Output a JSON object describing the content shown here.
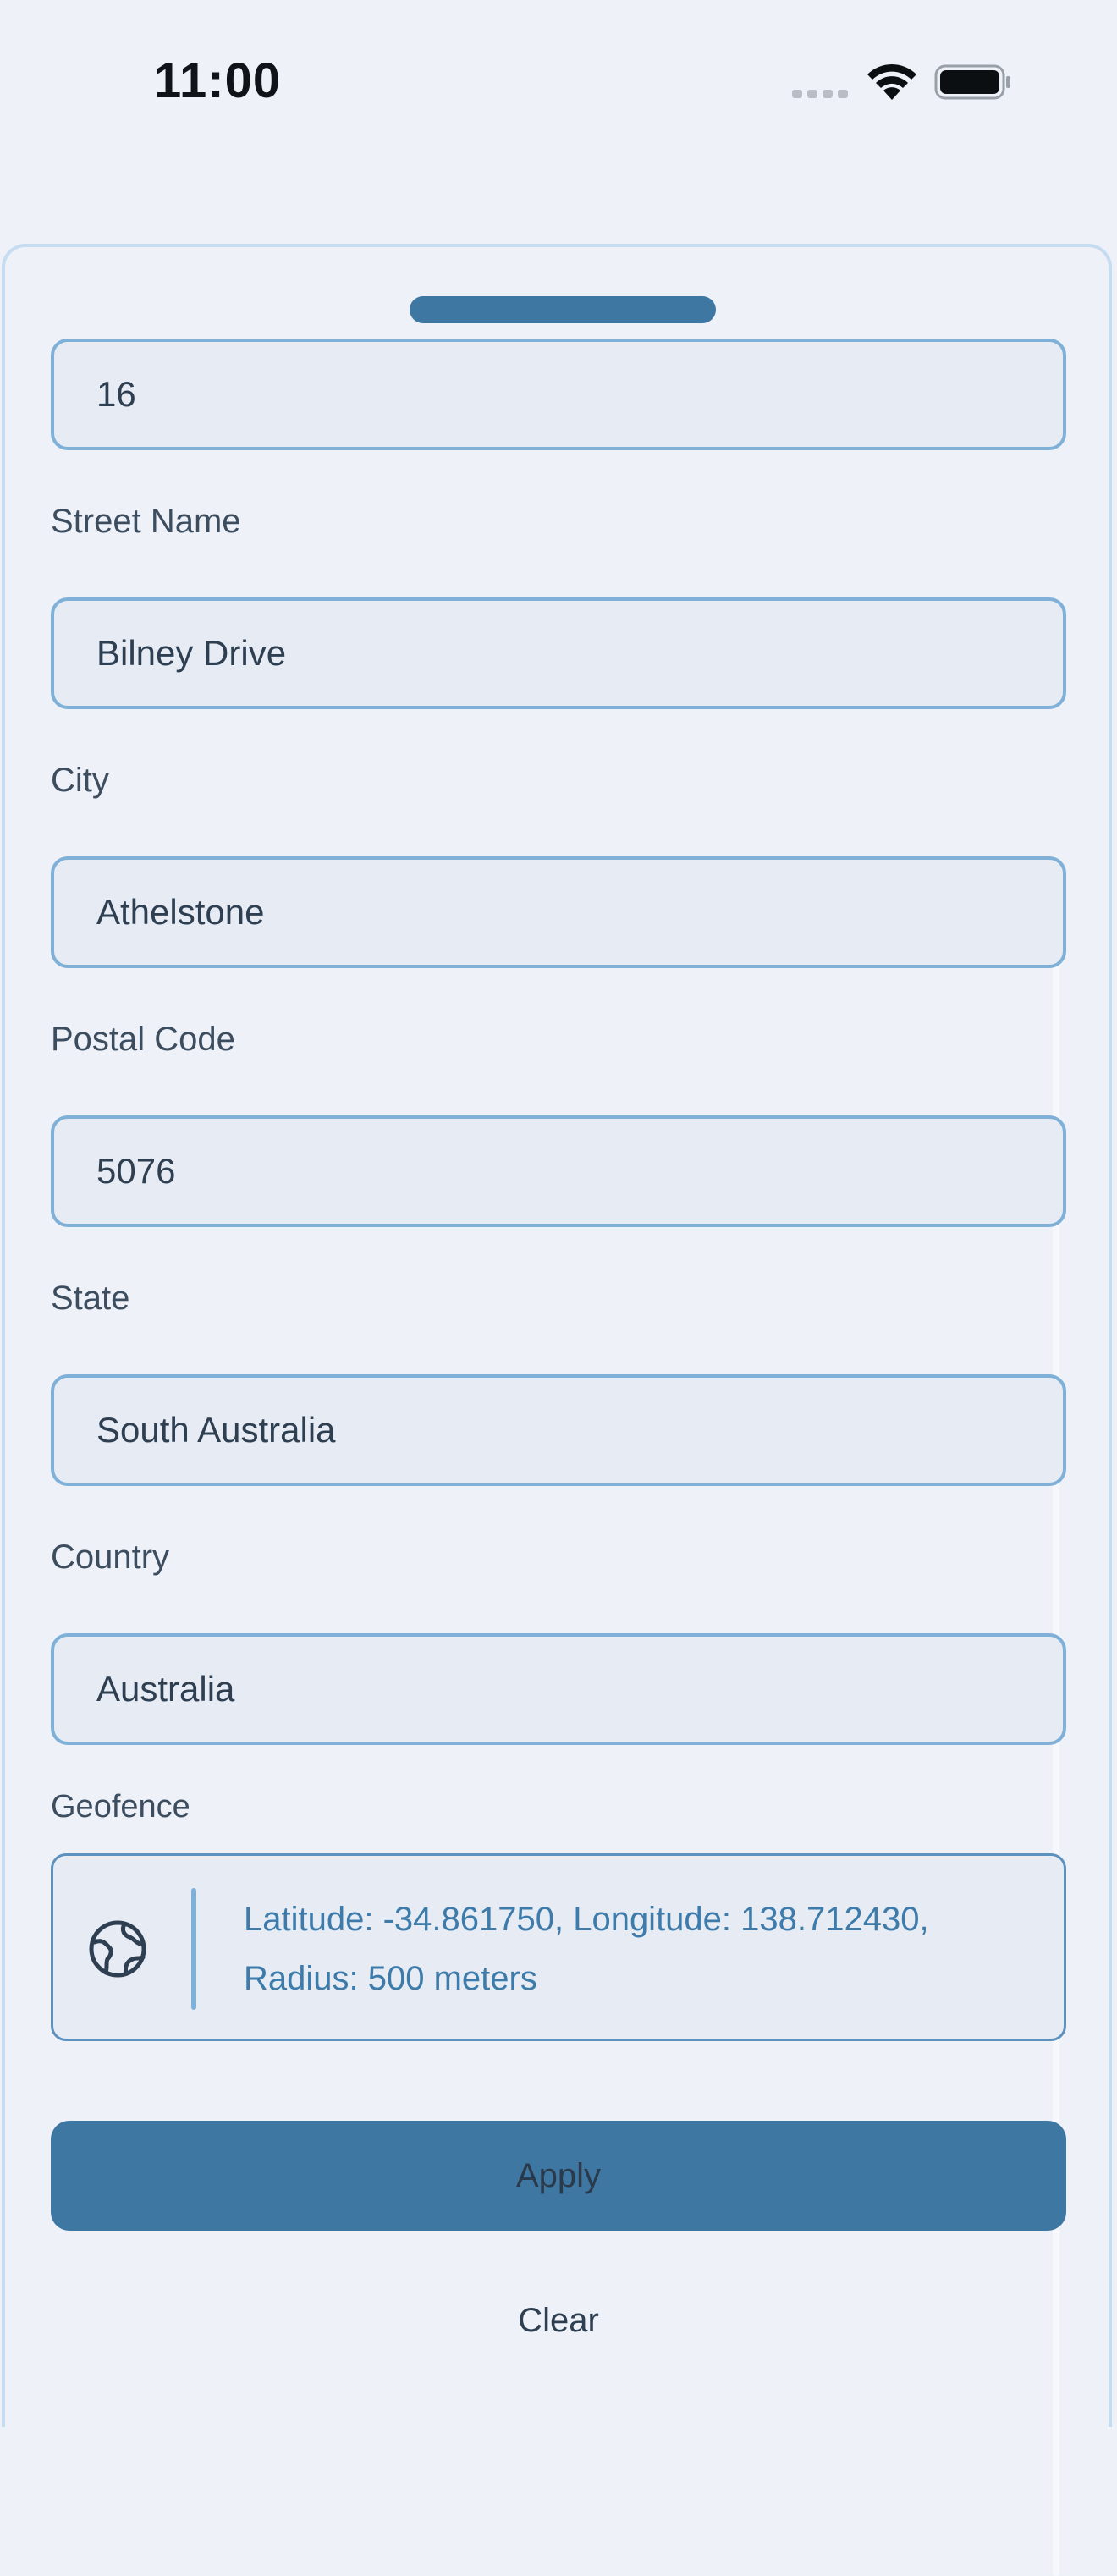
{
  "status_bar": {
    "time": "11:00"
  },
  "form": {
    "street_number": {
      "value": "16"
    },
    "street_name": {
      "label": "Street Name",
      "value": "Bilney Drive"
    },
    "city": {
      "label": "City",
      "value": "Athelstone"
    },
    "postal_code": {
      "label": "Postal Code",
      "value": "5076"
    },
    "state": {
      "label": "State",
      "value": "South Australia"
    },
    "country": {
      "label": "Country",
      "value": "Australia"
    },
    "geofence": {
      "label": "Geofence",
      "line1": "Latitude: -34.861750, Longitude: 138.712430,",
      "line2": "Radius: 500 meters"
    }
  },
  "actions": {
    "apply_label": "Apply",
    "clear_label": "Clear"
  },
  "colors": {
    "accent": "#3f77a3",
    "field_border": "#7fb0d8",
    "background": "#eef2f8"
  }
}
